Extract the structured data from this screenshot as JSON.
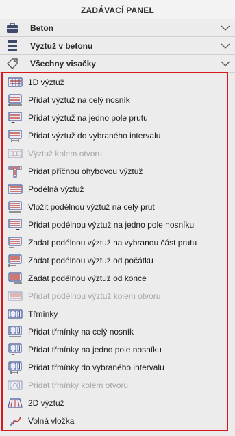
{
  "panel": {
    "title": "ZADÁVACÍ PANEL"
  },
  "sections": [
    {
      "label": "Beton",
      "icon": "toolbox-icon"
    },
    {
      "label": "Výztuž v betonu",
      "icon": "stack-icon"
    },
    {
      "label": "Všechny visačky",
      "icon": "tag-icon"
    }
  ],
  "items": [
    {
      "label": "1D výztuž",
      "icon": "rebar-1d-icon",
      "enabled": true
    },
    {
      "label": "Přidat výztuž na celý nosník",
      "icon": "rebar-whole-beam-icon",
      "enabled": true
    },
    {
      "label": "Přidat výztuž na jedno pole prutu",
      "icon": "rebar-one-span-icon",
      "enabled": true
    },
    {
      "label": "Přidat výztuž do vybraného intervalu",
      "icon": "rebar-interval-icon",
      "enabled": true
    },
    {
      "label": "Výztuž kolem otvoru",
      "icon": "rebar-opening-icon",
      "enabled": false
    },
    {
      "label": "Přidat příčnou ohybovou výztuž",
      "icon": "transverse-bend-rebar-icon",
      "enabled": true
    },
    {
      "label": "Podélná výztuž",
      "icon": "longitudinal-rebar-icon",
      "enabled": true
    },
    {
      "label": "Vložit podélnou výztuž na celý prut",
      "icon": "longitudinal-whole-member-icon",
      "enabled": true
    },
    {
      "label": "Přidat podélnou výztuž na jedno pole nosníku",
      "icon": "longitudinal-one-span-icon",
      "enabled": true
    },
    {
      "label": "Zadat podélnou výztuž na vybranou část prutu",
      "icon": "longitudinal-part-icon",
      "enabled": true
    },
    {
      "label": "Zadat podélnou výztuž od počátku",
      "icon": "longitudinal-from-start-icon",
      "enabled": true
    },
    {
      "label": "Zadat podélnou výztuž od konce",
      "icon": "longitudinal-from-end-icon",
      "enabled": true
    },
    {
      "label": "Přidat podélnou výztuž kolem otvoru",
      "icon": "longitudinal-opening-icon",
      "enabled": false
    },
    {
      "label": "Třmínky",
      "icon": "stirrups-icon",
      "enabled": true
    },
    {
      "label": "Přidat třmínky na celý nosník",
      "icon": "stirrups-whole-beam-icon",
      "enabled": true
    },
    {
      "label": "Přidat třmínky na jedno pole nosníku",
      "icon": "stirrups-one-span-icon",
      "enabled": true
    },
    {
      "label": "Přidat třmínky do vybraného intervalu",
      "icon": "stirrups-interval-icon",
      "enabled": true
    },
    {
      "label": "Přidat třmínky kolem otvoru",
      "icon": "stirrups-opening-icon",
      "enabled": false
    },
    {
      "label": "2D výztuž",
      "icon": "rebar-2d-icon",
      "enabled": true
    },
    {
      "label": "Volná vložka",
      "icon": "free-insert-icon",
      "enabled": true
    }
  ],
  "colors": {
    "highlight_border": "#d7181c",
    "icon_red": "#c0392b",
    "icon_blue": "#4a5a9a",
    "background": "#ececec"
  }
}
